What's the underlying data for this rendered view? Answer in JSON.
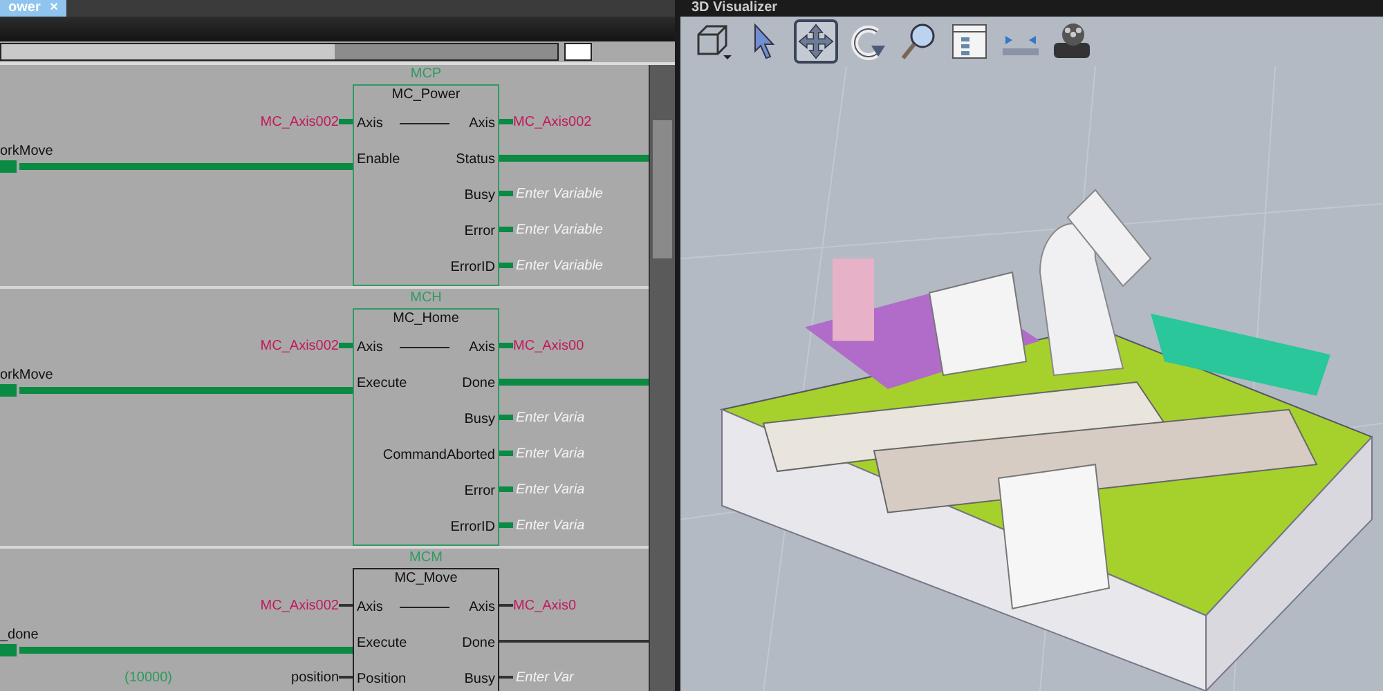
{
  "editor": {
    "tab": {
      "label": "ower",
      "close": "×"
    },
    "rungs": [
      {
        "label": "MCP",
        "instruction": "MC_Power",
        "active": true,
        "inputs": [
          {
            "kind": "variable",
            "pin": "Axis",
            "variable": "MC_Axis002"
          },
          {
            "kind": "contact",
            "pin": "Enable",
            "contact": "orkMove",
            "powered": true
          }
        ],
        "outputs": [
          {
            "kind": "variable",
            "pin": "Axis",
            "variable": "MC_Axis002"
          },
          {
            "kind": "wire",
            "pin": "Status",
            "powered": true
          },
          {
            "kind": "placeholder",
            "pin": "Busy",
            "placeholder": "Enter Variable"
          },
          {
            "kind": "placeholder",
            "pin": "Error",
            "placeholder": "Enter Variable"
          },
          {
            "kind": "placeholder",
            "pin": "ErrorID",
            "placeholder": "Enter Variable"
          }
        ]
      },
      {
        "label": "MCH",
        "instruction": "MC_Home",
        "active": true,
        "inputs": [
          {
            "kind": "variable",
            "pin": "Axis",
            "variable": "MC_Axis002"
          },
          {
            "kind": "contact",
            "pin": "Execute",
            "contact": "orkMove",
            "powered": true
          }
        ],
        "outputs": [
          {
            "kind": "variable",
            "pin": "Axis",
            "variable": "MC_Axis00"
          },
          {
            "kind": "wire",
            "pin": "Done",
            "powered": true
          },
          {
            "kind": "placeholder",
            "pin": "Busy",
            "placeholder": "Enter Varia"
          },
          {
            "kind": "placeholder",
            "pin": "CommandAborted",
            "placeholder": "Enter Varia"
          },
          {
            "kind": "placeholder",
            "pin": "Error",
            "placeholder": "Enter Varia"
          },
          {
            "kind": "placeholder",
            "pin": "ErrorID",
            "placeholder": "Enter Varia"
          }
        ]
      },
      {
        "label": "MCM",
        "instruction": "MC_Move",
        "active": false,
        "inputs": [
          {
            "kind": "variable",
            "pin": "Axis",
            "variable": "MC_Axis002"
          },
          {
            "kind": "contact",
            "pin": "Execute",
            "contact": "_done",
            "powered": true
          },
          {
            "kind": "variable",
            "pin": "Position",
            "variable": "position",
            "value": "(10000)"
          }
        ],
        "outputs": [
          {
            "kind": "variable",
            "pin": "Axis",
            "variable": "MC_Axis0"
          },
          {
            "kind": "wire",
            "pin": "Done",
            "powered": false
          },
          {
            "kind": "placeholder",
            "pin": "Busy",
            "placeholder": "Enter Var"
          }
        ]
      }
    ]
  },
  "visualizer": {
    "title": "3D Visualizer",
    "tools": [
      {
        "kind": "view",
        "selected": false
      },
      {
        "kind": "select",
        "selected": false
      },
      {
        "kind": "pan",
        "selected": true
      },
      {
        "kind": "rotate",
        "selected": false
      },
      {
        "kind": "zoom",
        "selected": false
      },
      {
        "kind": "list",
        "selected": false
      },
      {
        "kind": "timeline",
        "selected": false
      },
      {
        "kind": "film",
        "selected": false
      }
    ]
  }
}
